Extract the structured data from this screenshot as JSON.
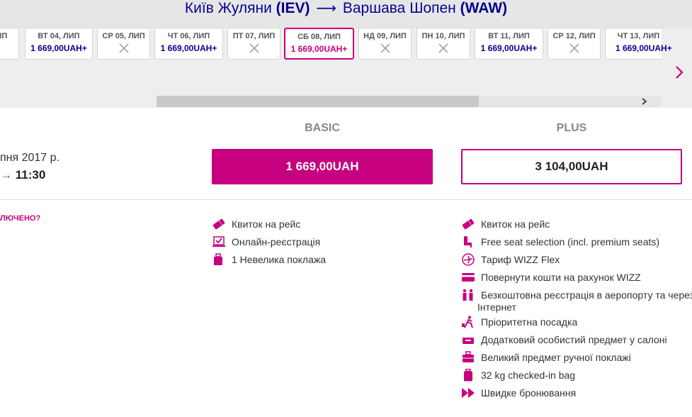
{
  "route": {
    "from_city": "Київ Жуляни",
    "from_code": "(IEV)",
    "to_city": "Варшава Шопен",
    "to_code": "(WAW)"
  },
  "dates": [
    {
      "label": "ЛИП",
      "price": "",
      "available": false
    },
    {
      "label": "ВТ 04, ЛИП",
      "price": "1 669,00UAH+",
      "available": true
    },
    {
      "label": "СР 05, ЛИП",
      "price": "",
      "available": false
    },
    {
      "label": "ЧТ 06, ЛИП",
      "price": "1 669,00UAH+",
      "available": true
    },
    {
      "label": "ПТ 07, ЛИП",
      "price": "",
      "available": false
    },
    {
      "label": "СБ 08, ЛИП",
      "price": "1 669,00UAH+",
      "available": true,
      "selected": true
    },
    {
      "label": "НД 09, ЛИП",
      "price": "",
      "available": false
    },
    {
      "label": "ПН 10, ЛИП",
      "price": "",
      "available": false
    },
    {
      "label": "ВТ 11, ЛИП",
      "price": "1 669,00UAH+",
      "available": true
    },
    {
      "label": "СР 12, ЛИП",
      "price": "",
      "available": false
    },
    {
      "label": "ЧТ 13, ЛИП",
      "price": "1 669,00UAH+",
      "available": true
    }
  ],
  "flight": {
    "date_partial": "пня 2017 р.",
    "time_arrow": "→",
    "arrival": "11:30",
    "included_link": "ЛЮЧЕНО?"
  },
  "tiers": {
    "basic": {
      "title": "BASIC",
      "price": "1 669,00UAH",
      "features": [
        "Квиток на рейс",
        "Онлайн-реєстрація",
        "1 Невелика поклажа"
      ]
    },
    "plus": {
      "title": "PLUS",
      "price": "3 104,00UAH",
      "features": [
        "Квиток на рейс",
        "Free seat selection (incl. premium seats)",
        "Тариф WIZZ Flex",
        "Повернути кошти на рахунок WIZZ",
        "Безкоштовна реєстрація в аеропорту та через",
        "Пріоритетна посадка",
        "Додатковий особистий предмет у салоні",
        "Великий предмет ручної поклажі",
        "32 kg checked-in bag",
        "Швидке бронювання"
      ],
      "feature_wrap": "Інтернет"
    }
  },
  "colors": {
    "brand_magenta": "#c6007e",
    "brand_navy": "#06038d"
  },
  "icons": {
    "ticket": "ticket-icon",
    "checkin": "online-checkin-icon",
    "bag": "small-bag-icon",
    "seat": "seat-icon",
    "flex": "plane-flex-icon",
    "refund": "card-refund-icon",
    "airport_checkin": "people-checkin-icon",
    "priority": "priority-boarding-icon",
    "personal_item": "personal-item-icon",
    "cabin_bag": "cabin-bag-icon",
    "checked_bag": "checked-bag-icon",
    "fast_booking": "fast-forward-icon"
  }
}
